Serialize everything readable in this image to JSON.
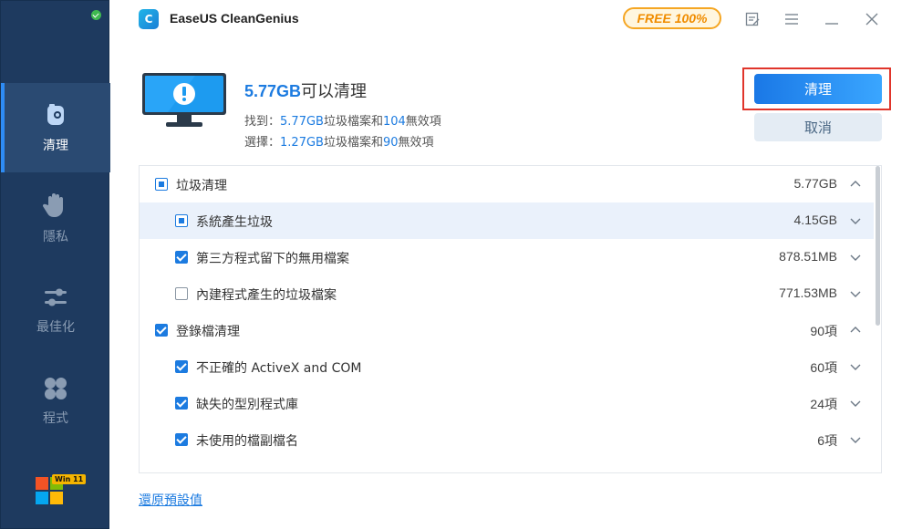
{
  "app": {
    "title": "EaseUS CleanGenius",
    "badge": "FREE 100%",
    "logo_letter": "C"
  },
  "sidebar": {
    "items": [
      {
        "label": "清理",
        "icon": "cleaner-icon",
        "active": true
      },
      {
        "label": "隱私",
        "icon": "hand-icon",
        "active": false
      },
      {
        "label": "最佳化",
        "icon": "sliders-icon",
        "active": false
      },
      {
        "label": "程式",
        "icon": "apps-icon",
        "active": false
      }
    ],
    "os_badge": "Win 11"
  },
  "summary": {
    "size": "5.77GB",
    "title_suffix": "可以清理",
    "found_prefix": "找到：",
    "found_size": "5.77GB",
    "found_mid": "垃圾檔案和",
    "found_count": "104",
    "found_suffix": "無效項",
    "selected_prefix": "選擇：",
    "selected_size": "1.27GB",
    "selected_mid": "垃圾檔案和",
    "selected_count": "90",
    "selected_suffix": "無效項"
  },
  "actions": {
    "clean_label": "清理",
    "cancel_label": "取消"
  },
  "list": {
    "rows": [
      {
        "label": "垃圾清理",
        "size": "5.77GB",
        "state": "partial",
        "level": 0,
        "chevron": "up"
      },
      {
        "label": "系統產生垃圾",
        "size": "4.15GB",
        "state": "partial",
        "level": 1,
        "chevron": "down",
        "selected": true
      },
      {
        "label": "第三方程式留下的無用檔案",
        "size": "878.51MB",
        "state": "checked",
        "level": 1,
        "chevron": "down"
      },
      {
        "label": "內建程式產生的垃圾檔案",
        "size": "771.53MB",
        "state": "empty",
        "level": 1,
        "chevron": "down"
      },
      {
        "label": "登錄檔清理",
        "size": "90項",
        "state": "checked",
        "level": 0,
        "chevron": "up"
      },
      {
        "label": "不正確的 ActiveX and COM",
        "size": "60項",
        "state": "checked",
        "level": 1,
        "chevron": "down"
      },
      {
        "label": "缺失的型別程式庫",
        "size": "24項",
        "state": "checked",
        "level": 1,
        "chevron": "down"
      },
      {
        "label": "未使用的檔副檔名",
        "size": "6項",
        "state": "checked",
        "level": 1,
        "chevron": "down"
      }
    ]
  },
  "footer": {
    "restore_label": "還原預設值"
  },
  "colors": {
    "accent": "#1c7be0",
    "sidebar_bg": "#1e3a5f",
    "badge_orange": "#f5a623",
    "highlight_red": "#e0352b"
  }
}
